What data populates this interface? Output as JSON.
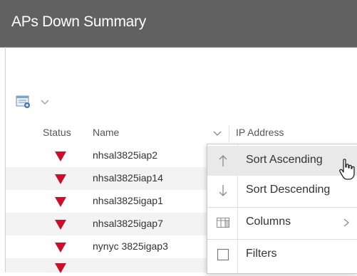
{
  "window": {
    "title": "APs Down Summary"
  },
  "toolbar": {
    "export_icon": "export-report-icon",
    "dropdown_icon": "chevron-down-icon"
  },
  "grid": {
    "columns": [
      "Status",
      "Name",
      "IP Address"
    ],
    "status_color": "#c8102e",
    "rows": [
      {
        "status": "down",
        "name": "nhsal3825iap2",
        "ip": ""
      },
      {
        "status": "down",
        "name": "nhsal3825iap14",
        "ip": ""
      },
      {
        "status": "down",
        "name": "nhsal3825igap1",
        "ip": ""
      },
      {
        "status": "down",
        "name": "nhsal3825igap7",
        "ip": ""
      },
      {
        "status": "down",
        "name": "nynyc 3825igap3",
        "ip": ""
      }
    ]
  },
  "column_menu": {
    "items": [
      {
        "label": "Sort Ascending",
        "icon": "arrow-up-icon"
      },
      {
        "label": "Sort Descending",
        "icon": "arrow-down-icon"
      },
      {
        "label": "Columns",
        "icon": "columns-icon"
      },
      {
        "label": "Filters",
        "icon": "checkbox-icon"
      }
    ]
  }
}
